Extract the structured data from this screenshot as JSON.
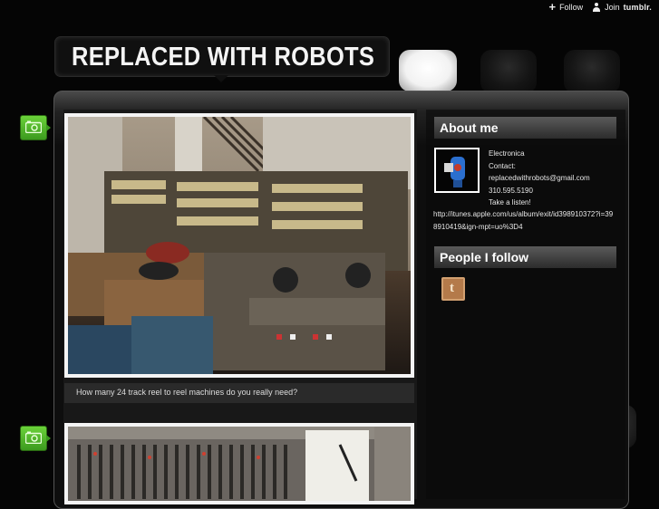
{
  "top_bar": {
    "follow_label": "Follow",
    "join_label": "Join",
    "brand": "tumblr."
  },
  "blog": {
    "title": "REPLACED WITH ROBOTS"
  },
  "posts": [
    {
      "type": "photo",
      "image_subject": "studio with rows of 24 track reel to reel tape machines",
      "caption": "How many 24 track reel to reel machines do you really need?"
    },
    {
      "type": "photo",
      "image_subject": "mixing console with faders and a notepad",
      "caption": ""
    }
  ],
  "sidebar": {
    "about_heading": "About me",
    "about_lines": [
      "Electronica",
      "Contact:",
      "replacedwithrobots@gmail.com",
      "310.595.5190",
      "Take a listen!"
    ],
    "about_url": "http://itunes.apple.com/us/album/exit/id398910372?i=398910419&ign-mpt=uo%3D4",
    "following_heading": "People I follow"
  },
  "colors": {
    "background": "#050505",
    "badge_green": "#4caf26",
    "sidebar_heading": "#3a3a3a",
    "photo_border": "#f4f4f4"
  },
  "icons": [
    "plus-icon",
    "user-icon",
    "camera-icon",
    "tumblr-t-icon"
  ]
}
